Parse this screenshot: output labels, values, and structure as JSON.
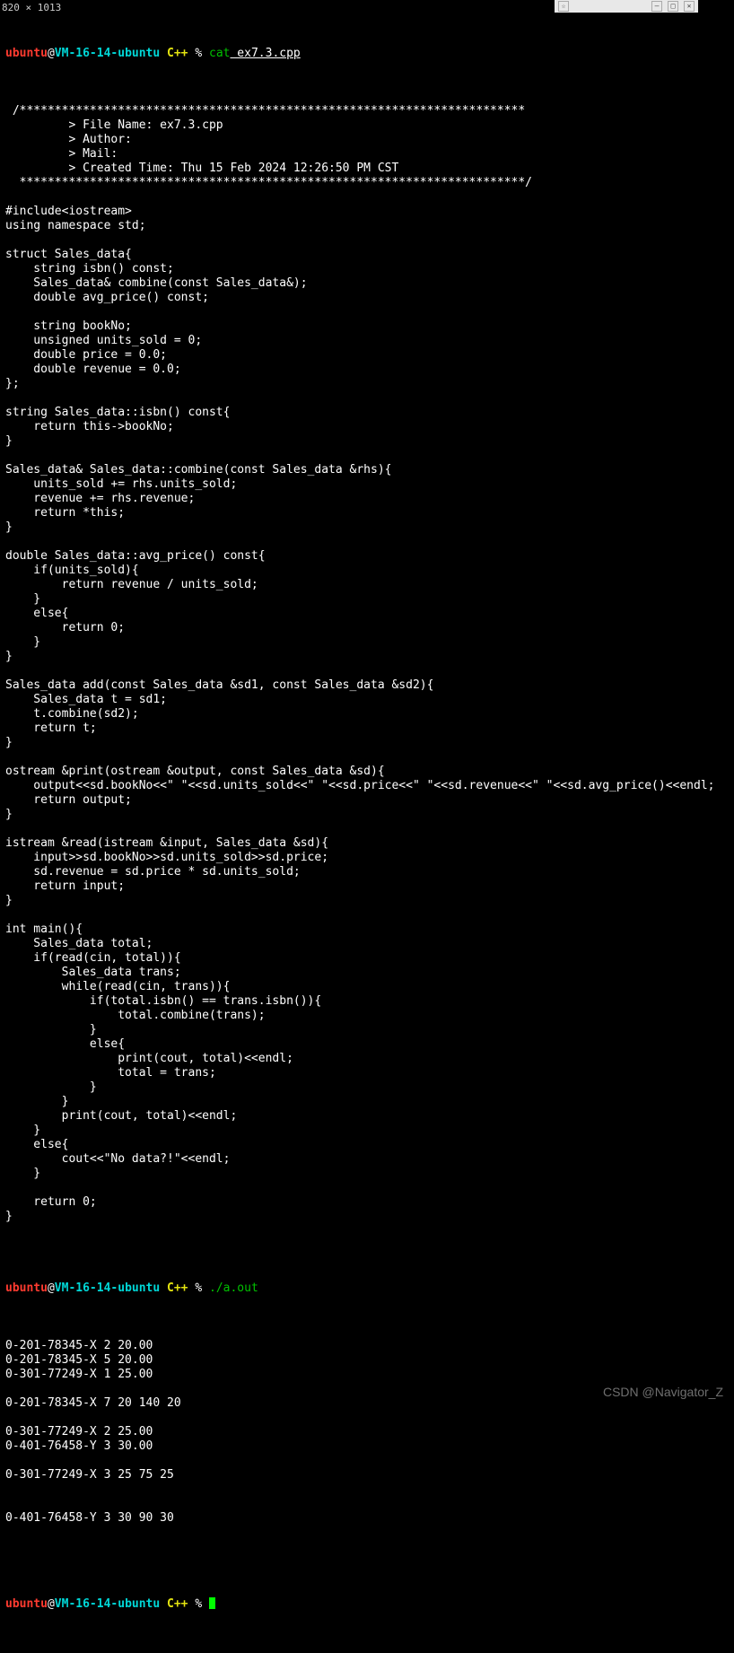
{
  "dimension_label": "820 × 1013",
  "browser_controls": {
    "star": "☆",
    "min": "—",
    "max": "□",
    "close": "✕",
    "label": ""
  },
  "prompt1": {
    "user": "ubuntu",
    "at": "@",
    "host": "VM-16-14-ubuntu",
    "path": " C++",
    "sep": " % ",
    "cmd": "cat",
    "arg": " ex7.3.cpp"
  },
  "code": [
    " /************************************************************************",
    "         > File Name: ex7.3.cpp",
    "         > Author:",
    "         > Mail:",
    "         > Created Time: Thu 15 Feb 2024 12:26:50 PM CST",
    "  ************************************************************************/",
    "",
    "#include<iostream>",
    "using namespace std;",
    "",
    "struct Sales_data{",
    "    string isbn() const;",
    "    Sales_data& combine(const Sales_data&);",
    "    double avg_price() const;",
    "",
    "    string bookNo;",
    "    unsigned units_sold = 0;",
    "    double price = 0.0;",
    "    double revenue = 0.0;",
    "};",
    "",
    "string Sales_data::isbn() const{",
    "    return this->bookNo;",
    "}",
    "",
    "Sales_data& Sales_data::combine(const Sales_data &rhs){",
    "    units_sold += rhs.units_sold;",
    "    revenue += rhs.revenue;",
    "    return *this;",
    "}",
    "",
    "double Sales_data::avg_price() const{",
    "    if(units_sold){",
    "        return revenue / units_sold;",
    "    }",
    "    else{",
    "        return 0;",
    "    }",
    "}",
    "",
    "Sales_data add(const Sales_data &sd1, const Sales_data &sd2){",
    "    Sales_data t = sd1;",
    "    t.combine(sd2);",
    "    return t;",
    "}",
    "",
    "ostream &print(ostream &output, const Sales_data &sd){",
    "    output<<sd.bookNo<<\" \"<<sd.units_sold<<\" \"<<sd.price<<\" \"<<sd.revenue<<\" \"<<sd.avg_price()<<endl;",
    "    return output;",
    "}",
    "",
    "istream &read(istream &input, Sales_data &sd){",
    "    input>>sd.bookNo>>sd.units_sold>>sd.price;",
    "    sd.revenue = sd.price * sd.units_sold;",
    "    return input;",
    "}",
    "",
    "int main(){",
    "    Sales_data total;",
    "    if(read(cin, total)){",
    "        Sales_data trans;",
    "        while(read(cin, trans)){",
    "            if(total.isbn() == trans.isbn()){",
    "                total.combine(trans);",
    "            }",
    "            else{",
    "                print(cout, total)<<endl;",
    "                total = trans;",
    "            }",
    "        }",
    "        print(cout, total)<<endl;",
    "    }",
    "    else{",
    "        cout<<\"No data?!\"<<endl;",
    "    }",
    "",
    "    return 0;",
    "}"
  ],
  "prompt2": {
    "user": "ubuntu",
    "at": "@",
    "host": "VM-16-14-ubuntu",
    "path": " C++",
    "sep": " % ",
    "cmd": "./a.out"
  },
  "runio": [
    "0-201-78345-X 2 20.00",
    "0-201-78345-X 5 20.00",
    "0-301-77249-X 1 25.00",
    "",
    "0-201-78345-X 7 20 140 20",
    "",
    "0-301-77249-X 2 25.00",
    "0-401-76458-Y 3 30.00",
    "",
    "0-301-77249-X 3 25 75 25",
    "",
    "",
    "0-401-76458-Y 3 30 90 30",
    ""
  ],
  "prompt3": {
    "user": "ubuntu",
    "at": "@",
    "host": "VM-16-14-ubuntu",
    "path": " C++",
    "sep": " % "
  },
  "watermark": "CSDN @Navigator_Z"
}
